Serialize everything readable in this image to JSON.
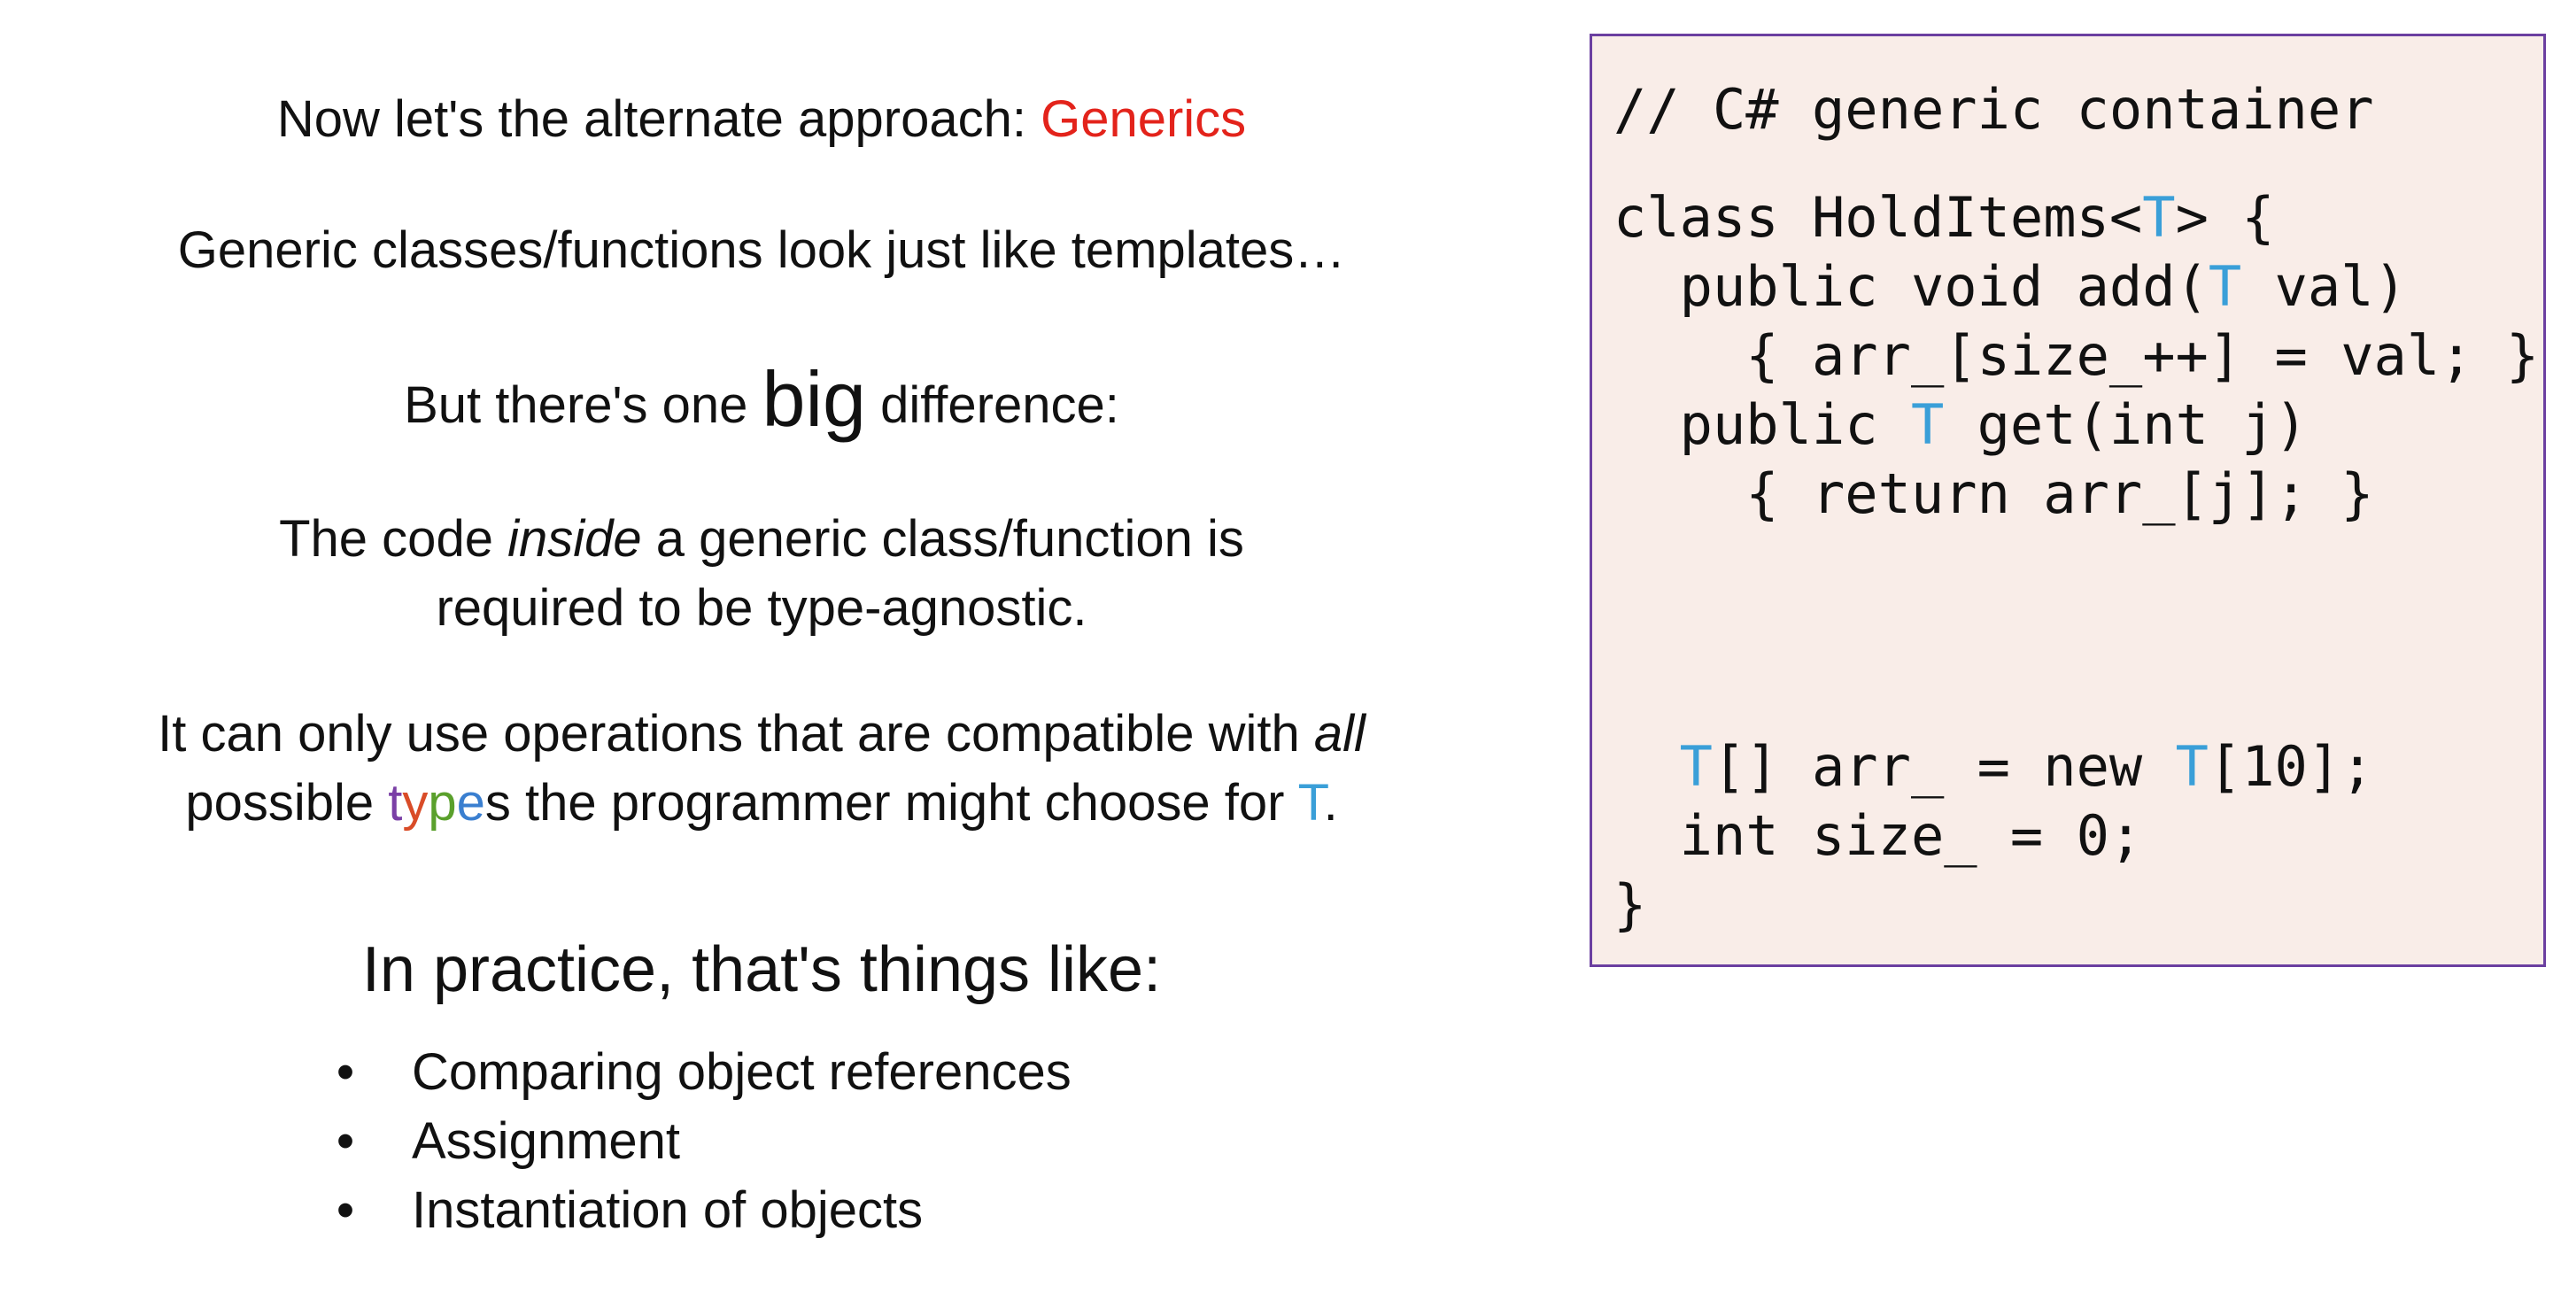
{
  "left": {
    "intro_prefix": "Now let's the alternate approach: ",
    "intro_highlight": "Generics",
    "line2": "Generic classes/functions look just like templates…",
    "line3_prefix": "But there's one ",
    "line3_big": "big",
    "line3_suffix": " difference:",
    "line4_prefix": "The code ",
    "line4_italic": "inside",
    "line4_suffix": " a generic class/function is",
    "line5": "required to be type-agnostic.",
    "line6_prefix": "It can only use operations that are compatible with ",
    "line6_italic": "all",
    "line7_prefix": "possible ",
    "line7_t": "t",
    "line7_y": "y",
    "line7_p": "p",
    "line7_e": "e",
    "line7_middle": "s the programmer might choose for ",
    "line7_T": "T",
    "line7_end": ".",
    "heading": "In practice, that's things like:",
    "bullet_char": "•",
    "bullets": [
      "Comparing object references",
      "Assignment",
      "Instantiation of objects"
    ]
  },
  "code": {
    "comment": "// C# generic container",
    "l1a": "class HoldItems<",
    "l1T": "T",
    "l1b": "> {",
    "l2a": "  public void add(",
    "l2T": "T",
    "l2b": " val)",
    "l3": "    { arr_[size_++] = val; }",
    "l4a": "  public ",
    "l4T": "T",
    "l4b": " get(int j)",
    "l5": "    { return arr_[j]; }",
    "l6a": "  ",
    "l6T": "T",
    "l6b": "[] arr_ = new ",
    "l6T2": "T",
    "l6c": "[10];",
    "l7": "  int size_ = 0;",
    "l8": "}"
  },
  "colors": {
    "accent_red": "#e3231b",
    "type_param_blue": "#3a9fd8",
    "code_bg": "#f9ede8",
    "code_border": "#6b3fa0"
  }
}
